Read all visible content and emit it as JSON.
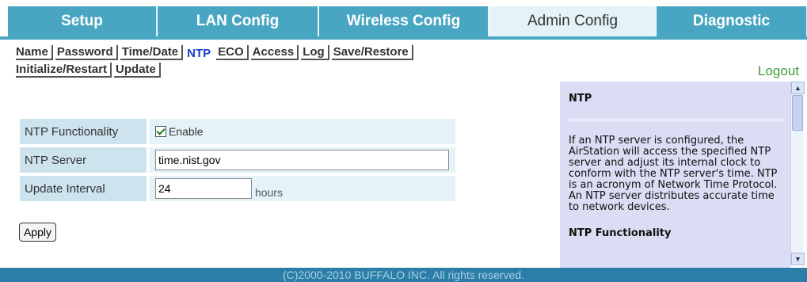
{
  "tabs": [
    {
      "label": "Setup"
    },
    {
      "label": "LAN Config"
    },
    {
      "label": "Wireless Config"
    },
    {
      "label": "Admin Config"
    },
    {
      "label": "Diagnostic"
    }
  ],
  "subnav": {
    "row1": [
      "Name",
      "Password",
      "Time/Date",
      "NTP",
      "ECO",
      "Access",
      "Log",
      "Save/Restore"
    ],
    "row2": [
      "Initialize/Restart",
      "Update"
    ],
    "active": "NTP",
    "logout": "Logout"
  },
  "form": {
    "ntp_functionality": {
      "label": "NTP Functionality",
      "checkbox_label": "Enable",
      "checked": true
    },
    "ntp_server": {
      "label": "NTP Server",
      "value": "time.nist.gov"
    },
    "update_interval": {
      "label": "Update Interval",
      "value": "24",
      "unit": "hours"
    },
    "apply_label": "Apply"
  },
  "help": {
    "title": "NTP",
    "body": "If an NTP server is configured, the AirStation will access the specified NTP server and adjust its internal clock to conform with the NTP server's time. NTP is an acronym of Network Time Protocol. An NTP server distributes accurate time to network devices.",
    "subtitle": "NTP Functionality"
  },
  "footer": "(C)2000-2010 BUFFALO INC. All rights reserved.",
  "colors": {
    "tab_bg": "#49a6c2",
    "tab_active_bg": "#e4f3f7",
    "active_link": "#1a3fc7",
    "logout": "#3b9d3b",
    "footer_bg": "#2b7ea8"
  }
}
